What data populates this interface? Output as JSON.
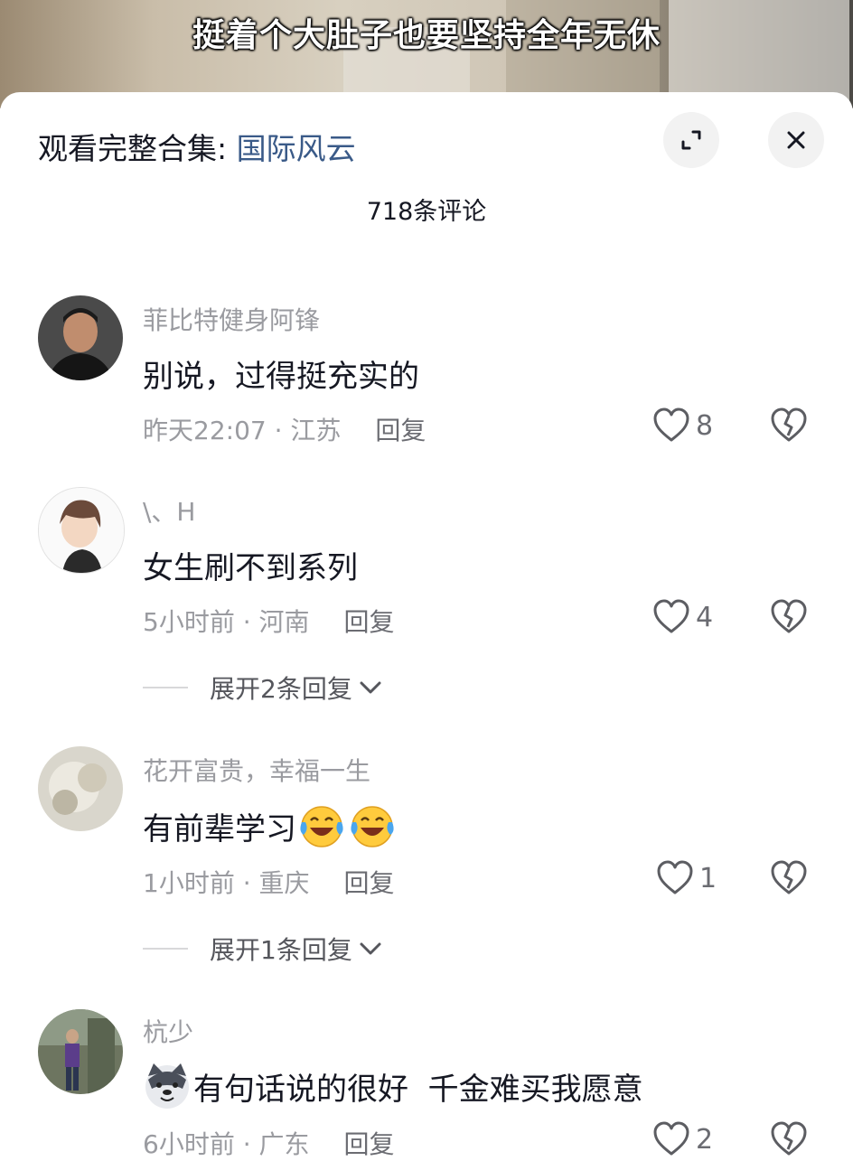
{
  "video": {
    "caption": "挺着个大肚子也要坚持全年无休"
  },
  "sheet": {
    "collection_prefix": "观看完整合集: ",
    "collection_name": "国际风云",
    "comment_count": "718条评论"
  },
  "comments": [
    {
      "user": "菲比特健身阿锋",
      "text": "别说，过得挺充实的",
      "time": "昨天22:07",
      "location": "江苏",
      "reply_label": "回复",
      "likes": "8",
      "expand_label": ""
    },
    {
      "user": "\\、H",
      "text": "女生刷不到系列",
      "time": "5小时前",
      "location": "河南",
      "reply_label": "回复",
      "likes": "4",
      "expand_label": "展开2条回复"
    },
    {
      "user": "花开富贵，幸福一生",
      "text": "有前辈学习",
      "time": "1小时前",
      "location": "重庆",
      "reply_label": "回复",
      "likes": "1",
      "expand_label": "展开1条回复"
    },
    {
      "user": "杭少",
      "text": "有句话说的很好  千金难买我愿意",
      "time": "6小时前",
      "location": "广东",
      "reply_label": "回复",
      "likes": "2",
      "expand_label": ""
    }
  ],
  "separator": " · ",
  "icons": {
    "expand": "fullscreen-icon",
    "close": "close-icon",
    "like": "heart-outline-icon",
    "dislike": "broken-heart-icon",
    "emoji": "laughing-crying-emoji-icon",
    "emoji_dog": "dog-face-emoji-icon",
    "chevron": "chevron-down-icon"
  }
}
